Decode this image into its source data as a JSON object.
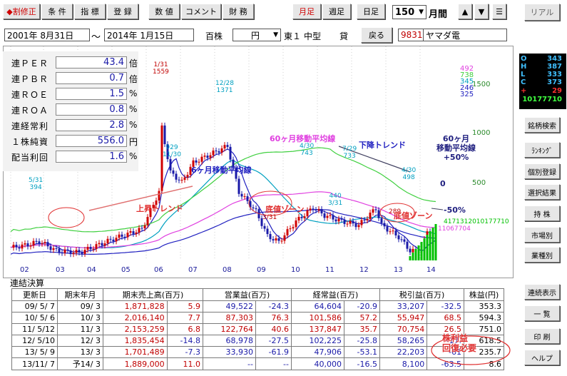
{
  "toolbar": {
    "buttons": [
      "◆割修正",
      "条 件",
      "指 標",
      "登 録",
      "数 値",
      "コメント",
      "財 務",
      "月足",
      "週足",
      "日足"
    ],
    "period_value": "150",
    "period_unit": "月間",
    "up_arrow": "▲",
    "down_arrow": "▼",
    "menu_icon": "☰",
    "real_button": "リアル"
  },
  "header": {
    "start_date": "2001年 8月31日",
    "tilde": "～",
    "end_date": "2014年 1月15日",
    "unit": "百株",
    "currency": "円",
    "market": "東１",
    "size": "中型",
    "lend": "貸",
    "back_button": "戻る",
    "code": "9831",
    "name": "ヤマダ電"
  },
  "indicators": [
    {
      "label": "連ＰＥＲ",
      "value": "43.4",
      "unit": "倍"
    },
    {
      "label": "連ＰＢＲ",
      "value": "0.7",
      "unit": "倍"
    },
    {
      "label": "連ＲＯＥ",
      "value": "1.5",
      "unit": "%"
    },
    {
      "label": "連ＲＯＡ",
      "value": "0.8",
      "unit": "%"
    },
    {
      "label": "連経常利",
      "value": "2.8",
      "unit": "%"
    },
    {
      "label": "１株純資",
      "value": "556.0",
      "unit": "円"
    },
    {
      "label": "配当利回",
      "value": "1.6",
      "unit": "%"
    }
  ],
  "ohlc": {
    "o": {
      "label": "O",
      "value": "343"
    },
    "h": {
      "label": "H",
      "value": "387"
    },
    "l": {
      "label": "L",
      "value": "333"
    },
    "c": {
      "label": "C",
      "value": "373"
    },
    "chg": {
      "label": "+",
      "value": "29"
    },
    "vol": {
      "value": "10177710"
    }
  },
  "side_menu": [
    "銘柄検索",
    "ﾗﾝｷﾝｸﾞ",
    "個別登録",
    "選択結果",
    "持 株",
    "市場別",
    "業種別",
    "連続表示",
    "一 覧",
    "印 刷",
    "ヘルプ"
  ],
  "chart": {
    "y_axis": [
      "1500",
      "1000",
      "500"
    ],
    "x_axis": [
      "02",
      "03",
      "04",
      "05",
      "06",
      "07",
      "08",
      "09",
      "10",
      "11",
      "12",
      "13",
      "14"
    ],
    "legend_values": [
      {
        "value": "492",
        "color": "#e040e0"
      },
      {
        "value": "738",
        "color": "#40d040"
      },
      {
        "value": "345",
        "color": "#00a0c0"
      },
      {
        "value": "246",
        "color": "#2020c0"
      },
      {
        "value": "325",
        "color": "#2020c0"
      }
    ],
    "price_labels": {
      "p1": "1/31\n1559",
      "p2": "12/28\n1371",
      "p3": "4/30\n743",
      "p4": "7/29\n733",
      "p5": "4/30\n498",
      "p6": "5/31\n394",
      "p7": "929\n11/30",
      "p8": "440\n3/31",
      "p9": "289",
      "p10": "3/31"
    },
    "volume_labels": [
      "4171312010177710",
      "11067704"
    ],
    "annotations": {
      "ma60_purple": "60ヶ月移動平均線",
      "downtrend": "下降トレンド",
      "ma60_right": "60ヶ月\n移動平均線\n+50%",
      "zero": "0",
      "minus50": "-50%",
      "ma6": "6ヶ月移動平均線",
      "uptrend": "上昇トレンド",
      "bottom1": "底値ゾーン",
      "bottom2": "底値ゾーン",
      "eps_note": "株利益\n回復必要"
    },
    "colors": {
      "candle_up": "#d00000",
      "candle_down": "#1a1aa8",
      "ma_short": "#2020c0",
      "ma_mid": "#e040e0",
      "ma_long": "#40d040",
      "ma_teal": "#00a0c0",
      "volume": "#00c000"
    }
  },
  "finance": {
    "title": "連結決算",
    "headers": [
      "更新日",
      "期末年月",
      "期末売上高(百万)",
      "",
      "営業益(百万)",
      "",
      "経常益(百万)",
      "",
      "税引益(百万)",
      "",
      "株益(円)"
    ],
    "rows": [
      [
        "09/ 5/ 7",
        "09/ 3",
        "1,871,828",
        "5.9",
        "49,522",
        "-24.3",
        "64,604",
        "-20.9",
        "33,207",
        "-32.5",
        "353.3"
      ],
      [
        "10/ 5/ 6",
        "10/ 3",
        "2,016,140",
        "7.7",
        "87,303",
        "76.3",
        "101,586",
        "57.2",
        "55,947",
        "68.5",
        "594.3"
      ],
      [
        "11/ 5/12",
        "11/ 3",
        "2,153,259",
        "6.8",
        "122,764",
        "40.6",
        "137,847",
        "35.7",
        "70,754",
        "26.5",
        "751.0"
      ],
      [
        "12/ 5/10",
        "12/ 3",
        "1,835,454",
        "-14.8",
        "68,978",
        "-27.5",
        "102,225",
        "-25.8",
        "58,265",
        "-17.",
        "618.5"
      ],
      [
        "13/ 5/ 9",
        "13/ 3",
        "1,701,489",
        "-7.3",
        "33,930",
        "-61.9",
        "47,906",
        "-53.1",
        "22,203",
        "-61",
        "235.7"
      ],
      [
        "13/11/ 7",
        "予14/ 3",
        "1,889,000",
        "11.0",
        "--",
        "--",
        "40,000",
        "-16.5",
        "8,100",
        "-63.5",
        "8.6"
      ]
    ]
  }
}
